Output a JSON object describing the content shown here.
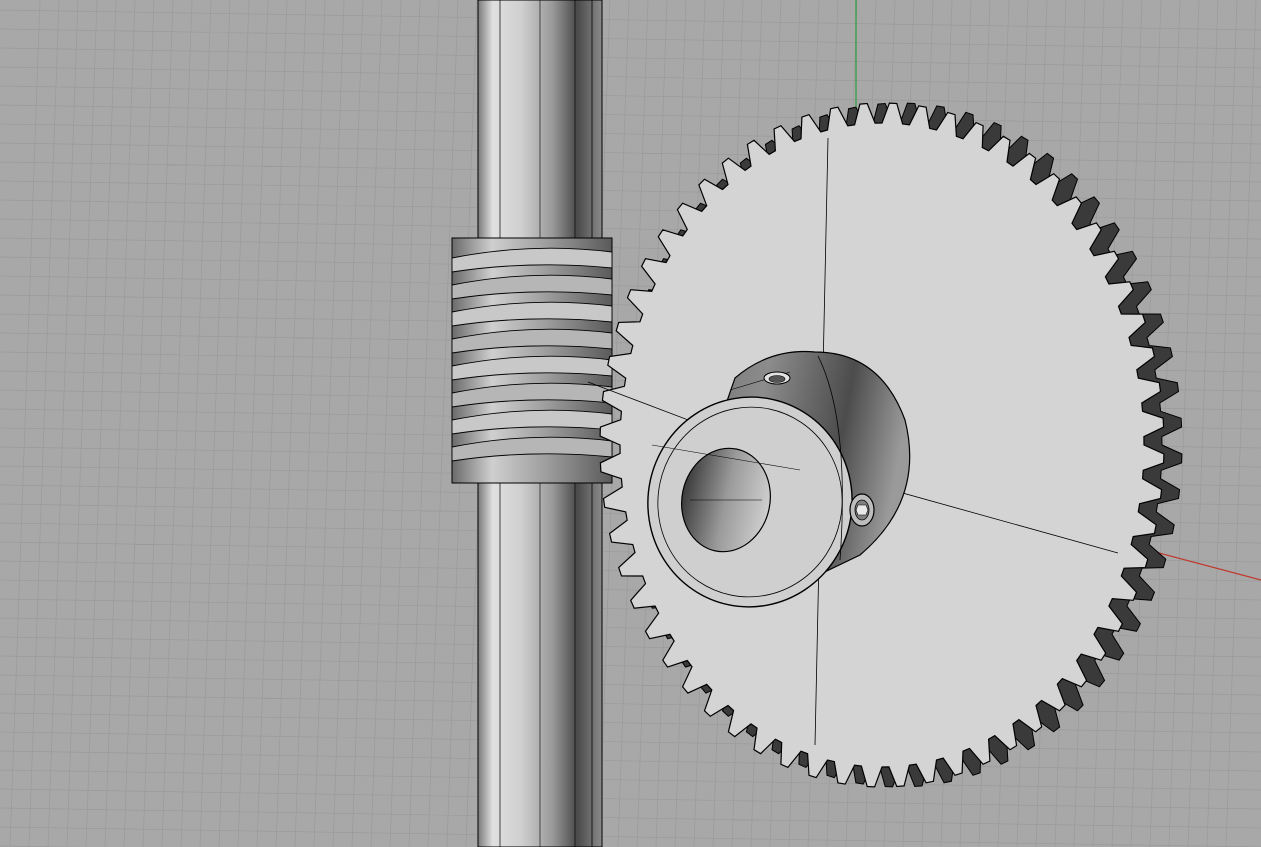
{
  "viewport": {
    "view": "perspective",
    "background": "#a8a8a8",
    "grid_color": "#9a9a9a",
    "axis_colors": {
      "x": "#c0392b",
      "y": "#2e9e3e"
    }
  },
  "scene": {
    "objects": [
      {
        "name": "shaft",
        "shading": "shaded-with-edges"
      },
      {
        "name": "worm",
        "threads": 8
      },
      {
        "name": "worm-gear",
        "teeth": 60
      },
      {
        "name": "hub",
        "features": [
          "bore",
          "set-screw",
          "oil-hole"
        ]
      }
    ]
  },
  "colors": {
    "shaft_light": "#d8d8d8",
    "shaft_dark": "#6e6e6e",
    "gear_face": "#d4d4d4",
    "gear_teeth_side": "#3a3a3a",
    "hub_face": "#cfcfcf",
    "edge": "#000000"
  }
}
